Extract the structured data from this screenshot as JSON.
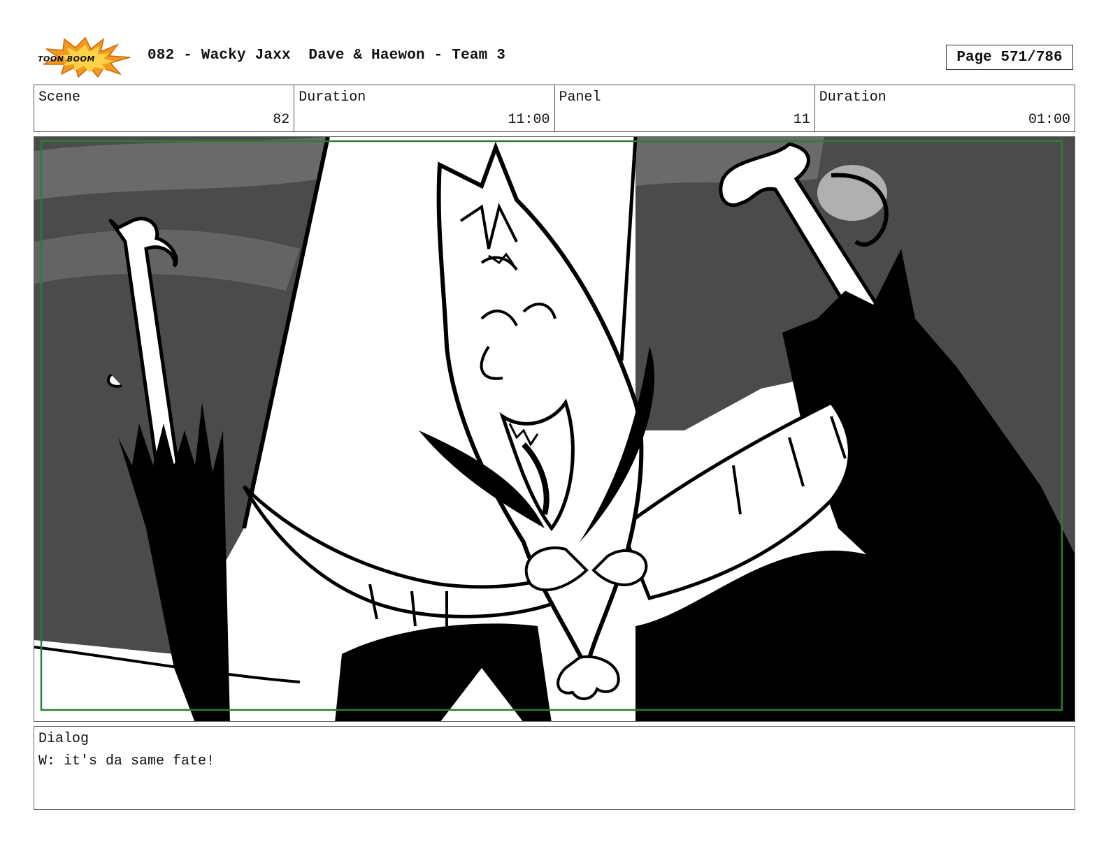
{
  "header": {
    "logo_text": "TOON BOOM",
    "title": "082 - Wacky Jaxx  Dave & Haewon - Team 3",
    "page": "Page 571/786"
  },
  "info": {
    "scene_label": "Scene",
    "scene_value": "82",
    "duration_label": "Duration",
    "duration_value": "11:00",
    "panel_label": "Panel",
    "panel_value": "11",
    "panel_duration_label": "Duration",
    "panel_duration_value": "01:00"
  },
  "dialog": {
    "label": "Dialog",
    "text": "W: it's da same fate!"
  },
  "colors": {
    "safe_frame": "#2e7d32",
    "dark_gray": "#4b4b4b",
    "mid_gray": "#6a6a6a",
    "logo_orange": "#f39a1e"
  }
}
